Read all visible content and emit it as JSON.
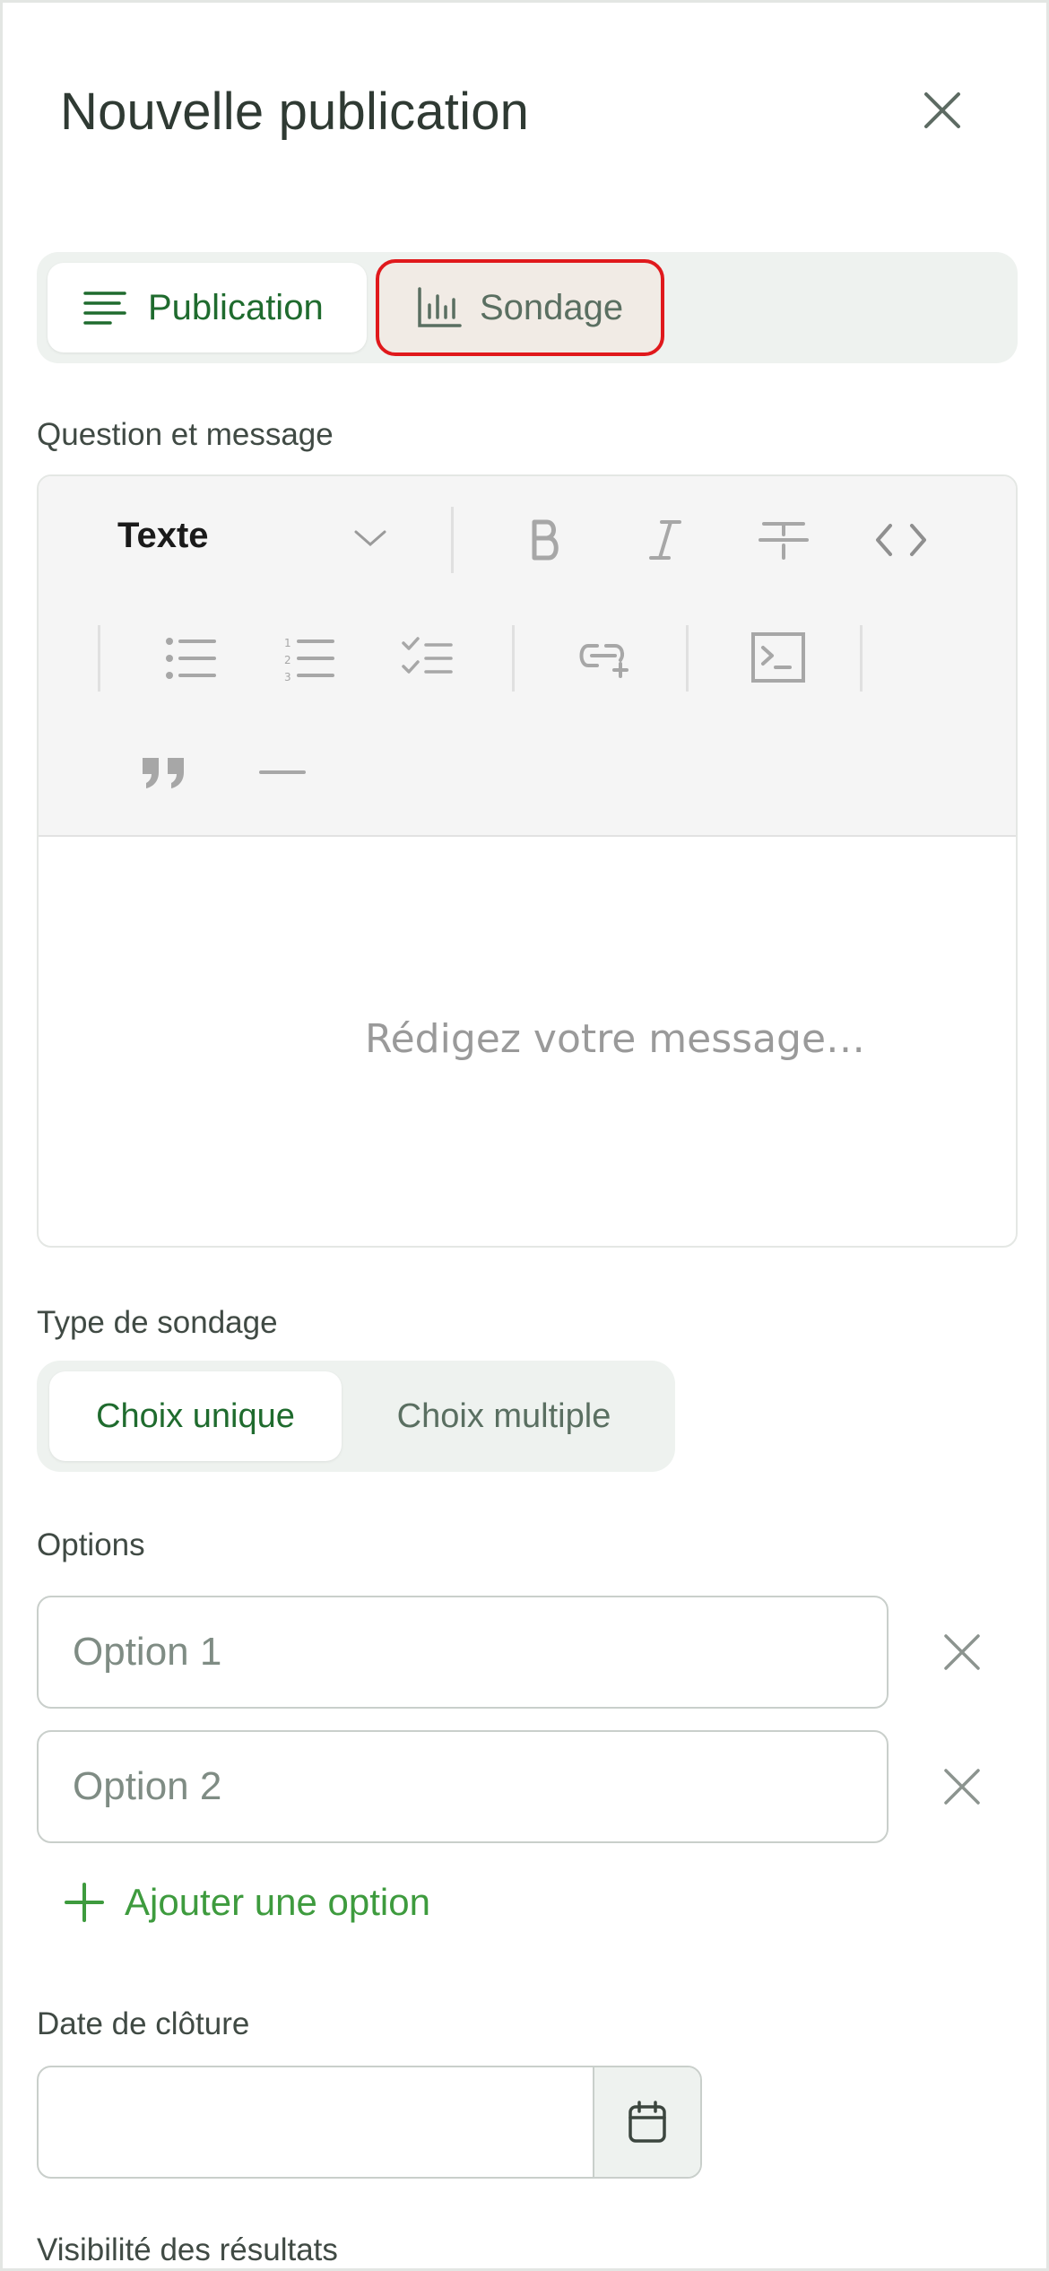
{
  "header": {
    "title": "Nouvelle publication",
    "close_icon": "close-icon"
  },
  "post_type_tabs": [
    {
      "label": "Publication",
      "icon": "lines-icon",
      "selected": true
    },
    {
      "label": "Sondage",
      "icon": "bar-chart-icon",
      "selected": false,
      "highlighted": true
    }
  ],
  "question": {
    "label": "Question et message",
    "format_select": "Texte",
    "placeholder": "Rédigez votre message…",
    "toolbar_icons": [
      "chevron-down-icon",
      "bold-icon",
      "italic-icon",
      "strikethrough-icon",
      "code-icon",
      "bullet-list-icon",
      "numbered-list-icon",
      "checklist-icon",
      "link-icon",
      "code-block-icon",
      "quote-icon",
      "horizontal-rule-icon"
    ]
  },
  "poll_type": {
    "label": "Type de sondage",
    "options": [
      {
        "label": "Choix unique",
        "selected": true
      },
      {
        "label": "Choix multiple",
        "selected": false
      }
    ]
  },
  "options": {
    "label": "Options",
    "items": [
      {
        "placeholder": "Option 1",
        "value": ""
      },
      {
        "placeholder": "Option 2",
        "value": ""
      }
    ],
    "add_label": "Ajouter une option"
  },
  "closing_date": {
    "label": "Date de clôture",
    "value": "",
    "icon": "calendar-icon"
  },
  "results_visibility": {
    "label": "Visibilité des résultats"
  },
  "colors": {
    "accent_green": "#1f6b2e",
    "add_green": "#3e9b3e",
    "highlight_red": "#e0191c"
  }
}
